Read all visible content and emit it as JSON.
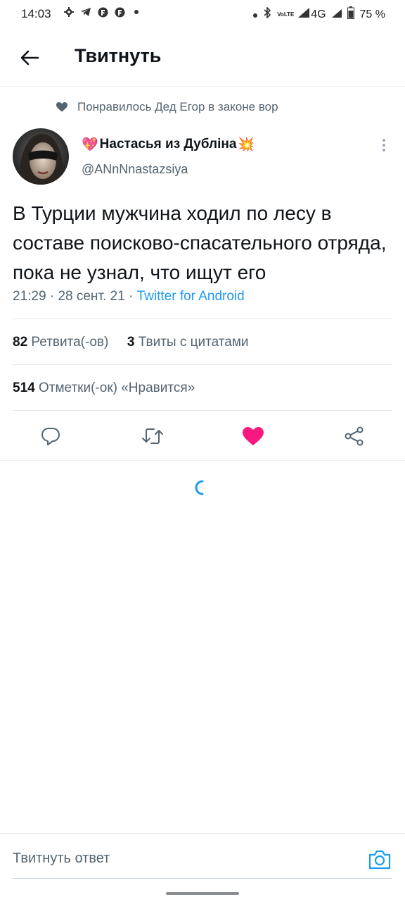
{
  "status_bar": {
    "time": "14:03",
    "network": "4G",
    "battery": "75 %",
    "left_icons": [
      "gear-icon",
      "telegram-icon",
      "notification-icon",
      "notification-icon",
      "dot-icon"
    ],
    "right_icons": [
      "dot-icon",
      "bluetooth-icon",
      "volte-icon",
      "signal-icon",
      "signal-icon",
      "battery-icon"
    ],
    "volte_label": "VoLTE"
  },
  "header": {
    "title": "Твитнуть",
    "back_icon": "arrow-left-icon"
  },
  "liked_by": {
    "text": "Понравилось Дед Егор в законе вор",
    "icon": "heart-icon"
  },
  "author": {
    "name": "Настасья из Дублiна",
    "handle": "@ANnNnastazsiya",
    "name_prefix_emoji": "💖",
    "name_suffix_emoji": "💥"
  },
  "tweet": {
    "text": "В Турции мужчина ходил по лесу в составе поисково-спасательного отряда, пока не узнал, что ищут его",
    "time": "21:29",
    "date": "28 сент. 21",
    "separator": " · ",
    "source": "Twitter for Android"
  },
  "stats": {
    "retweets_count": "82",
    "retweets_label": "Ретвита(-ов)",
    "quotes_count": "3",
    "quotes_label": "Твиты с цитатами",
    "likes_count": "514",
    "likes_label": "Отметки(-ок) «Нравится»"
  },
  "actions": [
    {
      "name": "reply",
      "icon": "comment-icon"
    },
    {
      "name": "retweet",
      "icon": "retweet-icon"
    },
    {
      "name": "like",
      "icon": "heart-filled-icon",
      "active": true,
      "color": "#f91880"
    },
    {
      "name": "share",
      "icon": "share-icon"
    }
  ],
  "reply_bar": {
    "placeholder": "Твитнуть ответ",
    "icon": "camera-icon"
  },
  "colors": {
    "accent": "#1d9bf0",
    "like": "#f91880",
    "muted": "#536471",
    "text": "#0f1419"
  }
}
